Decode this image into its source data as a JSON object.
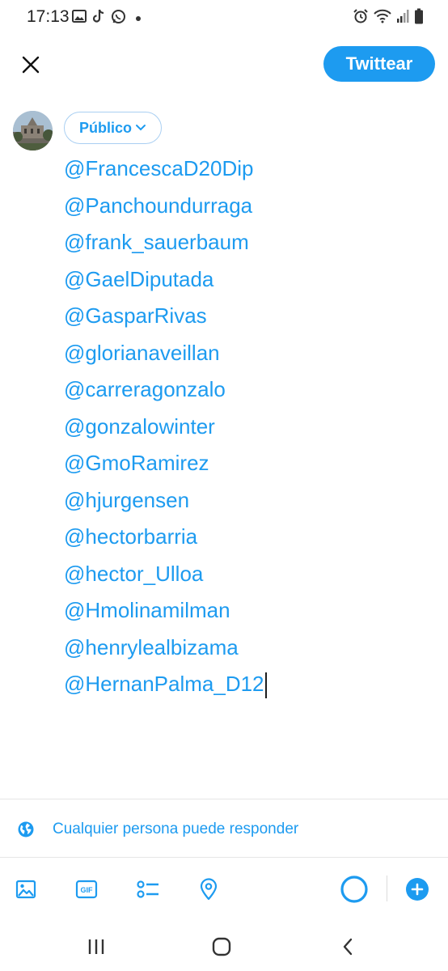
{
  "status_bar": {
    "time": "17:13",
    "left_icons": [
      "gallery-icon",
      "tiktok-icon",
      "whatsapp-icon",
      "notification-dot"
    ],
    "right_icons": [
      "alarm-icon",
      "wifi-icon",
      "signal-icon",
      "battery-icon"
    ]
  },
  "header": {
    "close_icon": "close-icon",
    "tweet_button_label": "Twittear"
  },
  "composer": {
    "audience_label": "Público",
    "mentions": [
      "@FrancescaD20Dip",
      "@Panchoundurraga",
      "@frank_sauerbaum",
      "@GaelDiputada",
      "@GasparRivas",
      "@glorianaveillan",
      "@carreragonzalo",
      "@gonzalowinter",
      "@GmoRamirez",
      "@hjurgensen",
      "@hectorbarria",
      "@hector_Ulloa",
      "@Hmolinamilman",
      "@henrylealbizama",
      "@HernanPalma_D12"
    ]
  },
  "reply_setting": {
    "icon": "globe-icon",
    "label": "Cualquier persona puede responder"
  },
  "toolbar": {
    "items": [
      "image-icon",
      "gif-icon",
      "poll-icon",
      "location-icon"
    ],
    "gif_text": "GIF",
    "progress_ring_fraction": 1.0,
    "add_icon": "add-thread-icon"
  },
  "nav_bar": {
    "items": [
      "recents-icon",
      "home-icon",
      "back-icon"
    ]
  },
  "colors": {
    "accent": "#1d9bf0",
    "accent_light_border": "#a9cff2",
    "text_dark": "#222222",
    "divider": "#e6e6e6"
  }
}
